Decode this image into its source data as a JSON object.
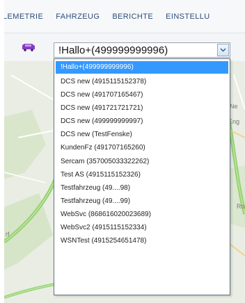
{
  "nav": {
    "items": [
      "LEMETRIE",
      "FAHRZEUG",
      "BERICHTE",
      "EINSTELLU"
    ]
  },
  "vehicle_select": {
    "value": "!Hallo+(499999999996)",
    "options": [
      {
        "label": "!Hallo+(499999999996)",
        "selected": true
      },
      {
        "label": "DCS new (4915115152378)"
      },
      {
        "label": "DCS new (491707165467)"
      },
      {
        "label": "DCS new (491721721721)"
      },
      {
        "label": "DCS new (499999999997)"
      },
      {
        "label": "DCS new (TestFenske)"
      },
      {
        "label": "KundenFz (491707165260)"
      },
      {
        "label": "Sercam (357005033322262)"
      },
      {
        "label": "Test AS (4915115152326)"
      },
      {
        "label": "Testfahrzeug (49....98)"
      },
      {
        "label": "Testfahrzeug (49....99)"
      },
      {
        "label": "WebSvc (868616020023689)"
      },
      {
        "label": "WebSvc2 (4915115152334)"
      },
      {
        "label": "WSNTest (4915254651478)"
      }
    ]
  },
  "map": {
    "labels": [
      "Ne",
      "Eng",
      "Ro",
      "rf"
    ]
  },
  "colors": {
    "nav_text": "#2b4d7a",
    "selected_bg": "#3399ff",
    "vehicle_icon": "#8a3cc8"
  },
  "icons": {
    "vehicle": "vehicle-icon",
    "dropdown": "chevron-down-icon"
  }
}
